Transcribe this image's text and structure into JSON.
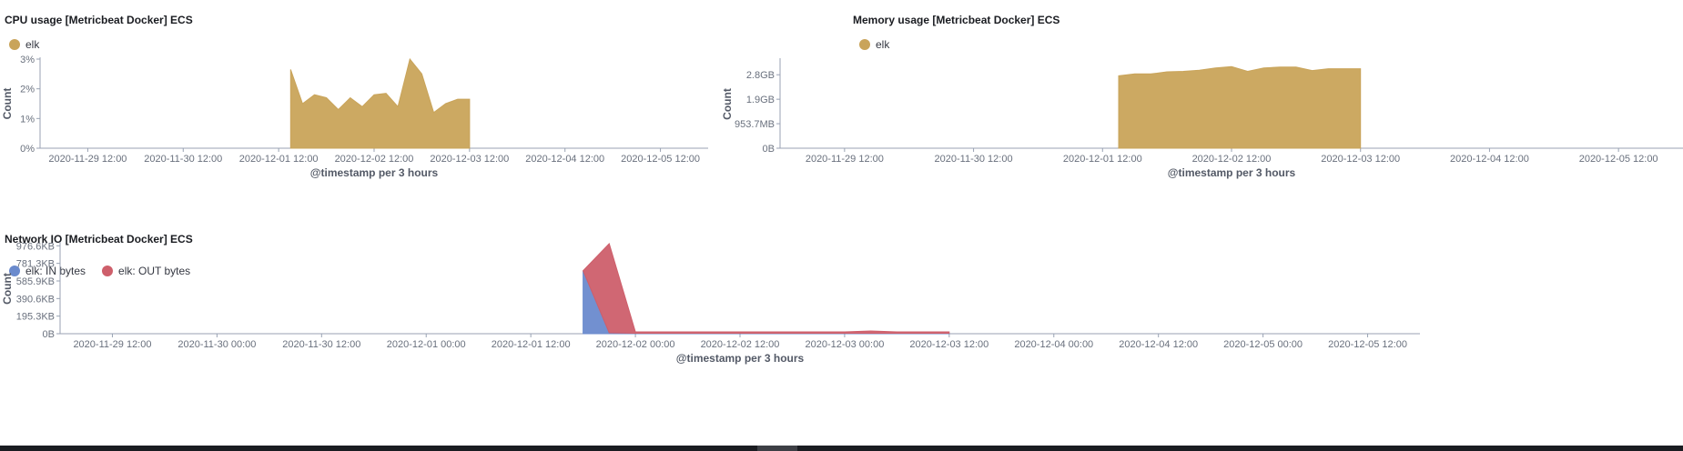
{
  "colors": {
    "gold": "#C9A45A",
    "blue": "#6A8ACD",
    "red": "#CE5F6B",
    "axis": "#98A2B3",
    "grid": "#E4E6EB",
    "text": "#69707D"
  },
  "cpu": {
    "title": "CPU usage [Metricbeat Docker] ECS",
    "legend": [
      {
        "label": "elk",
        "color": "#C9A45A"
      }
    ],
    "ylabel": "Count",
    "xlabel": "@timestamp per 3 hours",
    "yticks": [
      "0%",
      "1%",
      "2%",
      "3%"
    ],
    "xticks": [
      "2020-11-29 12:00",
      "2020-11-30 12:00",
      "2020-12-01 12:00",
      "2020-12-02 12:00",
      "2020-12-03 12:00",
      "2020-12-04 12:00",
      "2020-12-05 12:00"
    ]
  },
  "memory": {
    "title": "Memory usage [Metricbeat Docker] ECS",
    "legend": [
      {
        "label": "elk",
        "color": "#C9A45A"
      }
    ],
    "ylabel": "Count",
    "xlabel": "@timestamp per 3 hours",
    "yticks": [
      "0B",
      "953.7MB",
      "1.9GB",
      "2.8GB"
    ],
    "xticks": [
      "2020-11-29 12:00",
      "2020-11-30 12:00",
      "2020-12-01 12:00",
      "2020-12-02 12:00",
      "2020-12-03 12:00",
      "2020-12-04 12:00",
      "2020-12-05 12:00"
    ]
  },
  "network": {
    "title": "Network IO [Metricbeat Docker] ECS",
    "legend": [
      {
        "label": "elk: IN bytes",
        "color": "#6A8ACD"
      },
      {
        "label": "elk: OUT bytes",
        "color": "#CE5F6B"
      }
    ],
    "ylabel": "Count",
    "xlabel": "@timestamp per 3 hours",
    "yticks": [
      "0B",
      "195.3KB",
      "390.6KB",
      "585.9KB",
      "781.3KB",
      "976.6KB"
    ],
    "xticks": [
      "2020-11-29 12:00",
      "2020-11-30 00:00",
      "2020-11-30 12:00",
      "2020-12-01 00:00",
      "2020-12-01 12:00",
      "2020-12-02 00:00",
      "2020-12-02 12:00",
      "2020-12-03 00:00",
      "2020-12-03 12:00",
      "2020-12-04 00:00",
      "2020-12-04 12:00",
      "2020-12-05 00:00",
      "2020-12-05 12:00"
    ]
  },
  "chart_data": [
    {
      "type": "area",
      "title": "CPU usage [Metricbeat Docker] ECS",
      "xlabel": "@timestamp per 3 hours",
      "ylabel": "Count",
      "y_unit": "%",
      "ylim": [
        0,
        3
      ],
      "xlim": [
        "2020-11-29 00:00",
        "2020-12-06 00:00"
      ],
      "legend_position": "top-left",
      "series": [
        {
          "name": "elk",
          "color": "#C9A45A",
          "x": [
            "2020-12-01 15:00",
            "2020-12-01 18:00",
            "2020-12-01 21:00",
            "2020-12-02 00:00",
            "2020-12-02 03:00",
            "2020-12-02 06:00",
            "2020-12-02 09:00",
            "2020-12-02 12:00",
            "2020-12-02 15:00",
            "2020-12-02 18:00",
            "2020-12-02 21:00",
            "2020-12-03 00:00",
            "2020-12-03 03:00",
            "2020-12-03 06:00",
            "2020-12-03 09:00",
            "2020-12-03 12:00"
          ],
          "values": [
            2.65,
            1.5,
            1.8,
            1.7,
            1.3,
            1.7,
            1.4,
            1.8,
            1.85,
            1.4,
            3.0,
            2.5,
            1.2,
            1.5,
            1.65,
            1.65
          ]
        }
      ]
    },
    {
      "type": "area",
      "title": "Memory usage [Metricbeat Docker] ECS",
      "xlabel": "@timestamp per 3 hours",
      "ylabel": "Count",
      "y_unit": "GB",
      "ylim": [
        0,
        3.35
      ],
      "xlim": [
        "2020-11-29 00:00",
        "2020-12-06 00:00"
      ],
      "legend_position": "top-left",
      "series": [
        {
          "name": "elk",
          "color": "#C9A45A",
          "x": [
            "2020-12-01 15:00",
            "2020-12-01 18:00",
            "2020-12-01 21:00",
            "2020-12-02 00:00",
            "2020-12-02 03:00",
            "2020-12-02 06:00",
            "2020-12-02 09:00",
            "2020-12-02 12:00",
            "2020-12-02 15:00",
            "2020-12-02 18:00",
            "2020-12-02 21:00",
            "2020-12-03 00:00",
            "2020-12-03 03:00",
            "2020-12-03 06:00",
            "2020-12-03 09:00",
            "2020-12-03 12:00"
          ],
          "values": [
            2.75,
            2.82,
            2.82,
            2.9,
            2.92,
            2.96,
            3.05,
            3.1,
            2.92,
            3.05,
            3.08,
            3.08,
            2.95,
            3.02,
            3.02,
            3.02
          ]
        }
      ]
    },
    {
      "type": "area",
      "title": "Network IO [Metricbeat Docker] ECS",
      "xlabel": "@timestamp per 3 hours",
      "ylabel": "Count",
      "y_unit": "KB",
      "ylim": [
        0,
        1000
      ],
      "xlim": [
        "2020-11-29 06:00",
        "2020-12-05 18:00"
      ],
      "stacked": true,
      "legend_position": "top-left",
      "series": [
        {
          "name": "elk: IN bytes",
          "color": "#6A8ACD",
          "x": [
            "2020-12-01 18:00",
            "2020-12-01 21:00",
            "2020-12-02 00:00",
            "2020-12-02 03:00",
            "2020-12-02 06:00",
            "2020-12-02 09:00",
            "2020-12-02 12:00",
            "2020-12-02 15:00",
            "2020-12-02 18:00",
            "2020-12-02 21:00",
            "2020-12-03 00:00",
            "2020-12-03 03:00",
            "2020-12-03 06:00",
            "2020-12-03 09:00",
            "2020-12-03 12:00"
          ],
          "values": [
            700,
            10,
            5,
            5,
            5,
            5,
            5,
            5,
            5,
            5,
            5,
            5,
            5,
            5,
            5
          ]
        },
        {
          "name": "elk: OUT bytes",
          "color": "#CE5F6B",
          "x": [
            "2020-12-01 18:00",
            "2020-12-01 21:00",
            "2020-12-02 00:00",
            "2020-12-02 03:00",
            "2020-12-02 06:00",
            "2020-12-02 09:00",
            "2020-12-02 12:00",
            "2020-12-02 15:00",
            "2020-12-02 18:00",
            "2020-12-02 21:00",
            "2020-12-03 00:00",
            "2020-12-03 03:00",
            "2020-12-03 06:00",
            "2020-12-03 09:00",
            "2020-12-03 12:00"
          ],
          "values": [
            0,
            990,
            15,
            15,
            15,
            15,
            15,
            15,
            15,
            15,
            15,
            25,
            15,
            15,
            15
          ]
        }
      ]
    }
  ]
}
